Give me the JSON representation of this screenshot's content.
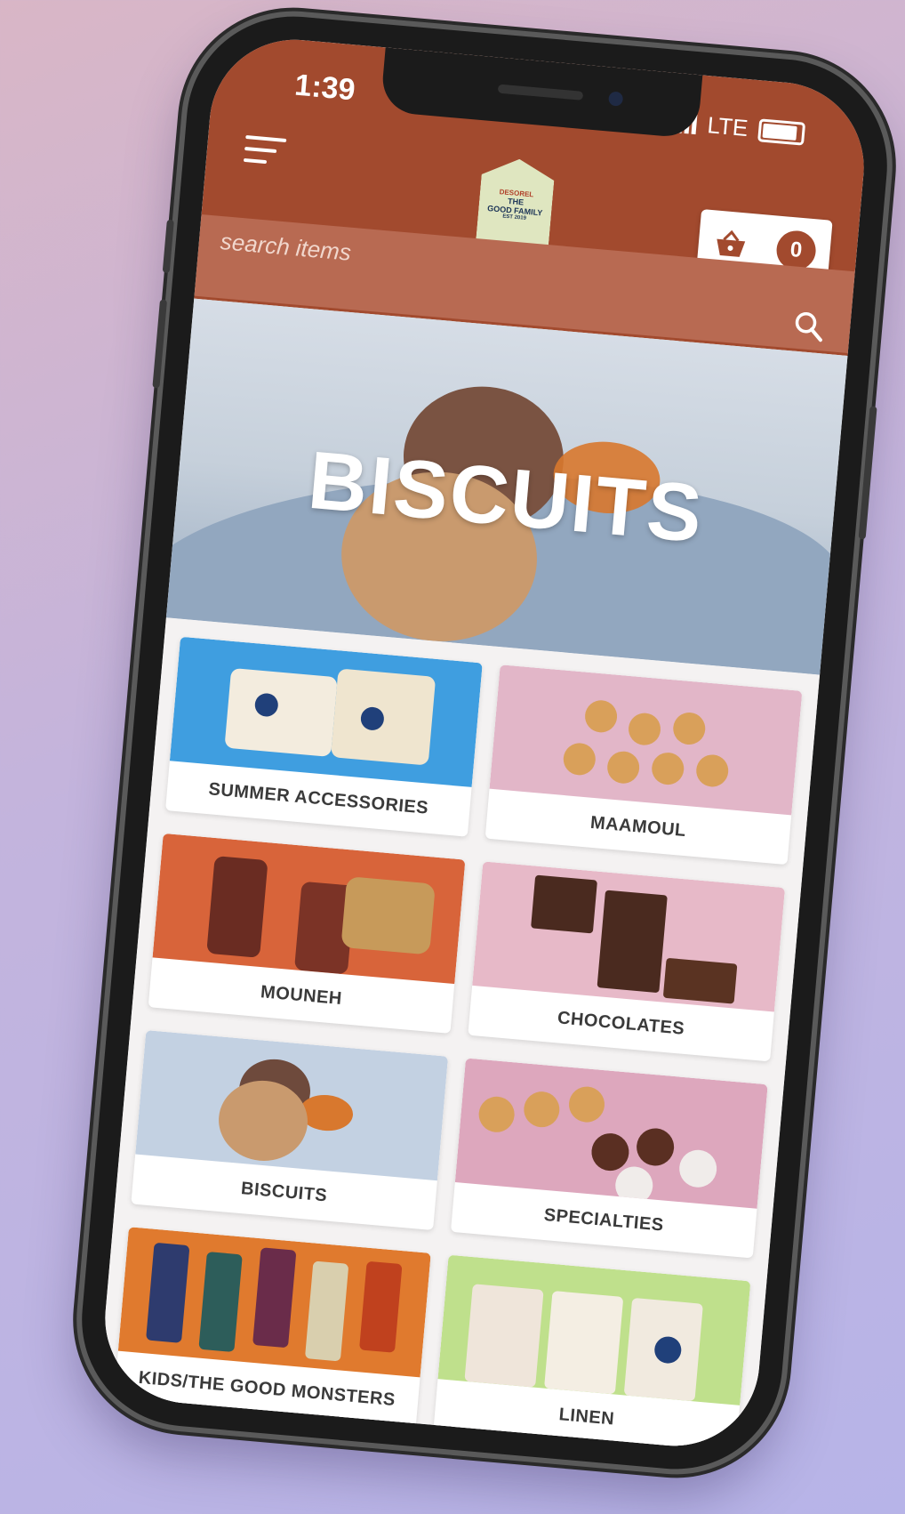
{
  "status_bar": {
    "time": "1:39",
    "network": "LTE"
  },
  "header": {
    "logo": {
      "line1": "DESOREL",
      "line2": "THE",
      "line3": "GOOD FAMILY",
      "line4": "EST 2019"
    },
    "cart": {
      "count": "0"
    }
  },
  "search": {
    "placeholder": "search items"
  },
  "hero": {
    "title": "BISCUITS"
  },
  "categories": [
    {
      "label": "SUMMER ACCESSORIES"
    },
    {
      "label": "MAAMOUL"
    },
    {
      "label": "MOUNEH"
    },
    {
      "label": "CHOCOLATES"
    },
    {
      "label": "BISCUITS"
    },
    {
      "label": "SPECIALTIES"
    },
    {
      "label": "KIDS/THE GOOD MONSTERS"
    },
    {
      "label": "LINEN"
    }
  ],
  "colors": {
    "brand": "#a24a2e",
    "search_bar": "#b86a52"
  }
}
